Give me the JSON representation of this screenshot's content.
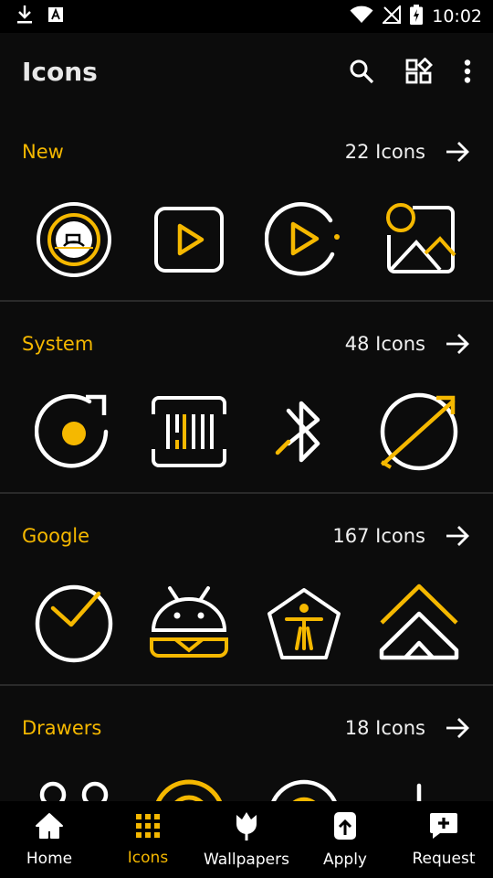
{
  "status": {
    "time": "10:02"
  },
  "appbar": {
    "title": "Icons"
  },
  "colors": {
    "accent": "#f5b800",
    "background": "#0c0c0c",
    "bar": "#000000"
  },
  "sections": [
    {
      "title": "New",
      "count": "22 Icons",
      "icons": [
        "camera-lens-icon",
        "play-square-icon",
        "play-circle-icon",
        "gallery-icon"
      ]
    },
    {
      "title": "System",
      "count": "48 Icons",
      "icons": [
        "record-rotate-icon",
        "barcode-scanner-icon",
        "bluetooth-icon",
        "telescope-icon"
      ]
    },
    {
      "title": "Google",
      "count": "167 Icons",
      "icons": [
        "clock-icon",
        "android-icon",
        "accessibility-icon",
        "google-home-icon"
      ]
    },
    {
      "title": "Drawers",
      "count": "18 Icons",
      "icons": [
        "tape-icon",
        "target-icon",
        "target-small-icon",
        "equalizer-icon"
      ]
    }
  ],
  "nav": [
    {
      "label": "Home",
      "icon": "home-icon"
    },
    {
      "label": "Icons",
      "icon": "grid-dots-icon",
      "active": true
    },
    {
      "label": "Wallpapers",
      "icon": "tulip-icon"
    },
    {
      "label": "Apply",
      "icon": "apply-icon"
    },
    {
      "label": "Request",
      "icon": "request-icon"
    }
  ]
}
